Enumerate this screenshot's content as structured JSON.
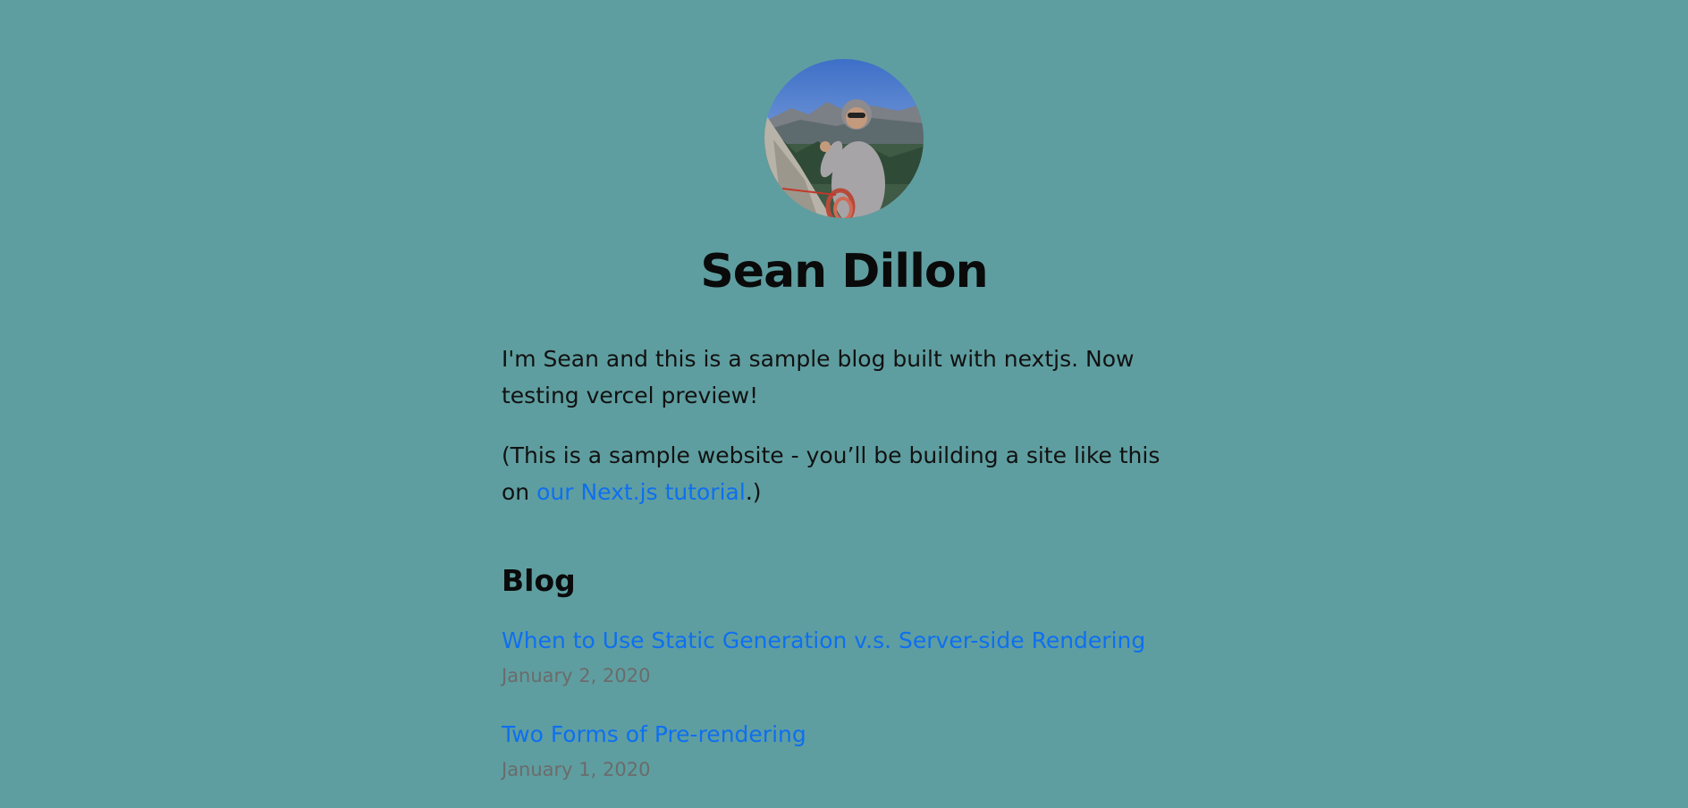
{
  "profile": {
    "name": "Sean Dillon",
    "avatar_icon": "avatar-photo"
  },
  "intro": {
    "paragraph1": "I'm Sean and this is a sample blog built with nextjs. Now testing vercel preview!",
    "paragraph2_before": "(This is a sample website - you’ll be building a site like this on ",
    "paragraph2_link": "our Next.js tutorial",
    "paragraph2_after": ".)"
  },
  "blog": {
    "heading": "Blog",
    "posts": [
      {
        "title": "When to Use Static Generation v.s. Server-side Rendering",
        "date": "January 2, 2020"
      },
      {
        "title": "Two Forms of Pre-rendering",
        "date": "January 1, 2020"
      }
    ]
  },
  "colors": {
    "background": "#5f9ea0",
    "link": "#0e6ff0",
    "date": "#6b6b6b"
  }
}
